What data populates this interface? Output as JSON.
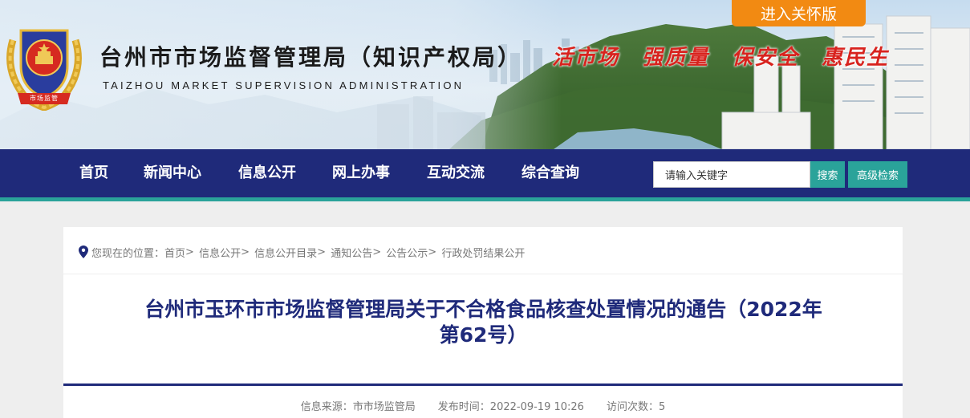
{
  "header": {
    "title_cn": "台州市市场监督管理局（知识产权局）",
    "title_en": "TAIZHOU MARKET SUPERVISION ADMINISTRATION",
    "slogan": "活市场　强质量　保安全　惠民生",
    "care_mode_label": "进入关怀版",
    "emblem_text": "市场监管",
    "colors": {
      "slogan": "#d8231e",
      "care_button": "#f28a12"
    }
  },
  "nav": {
    "items": [
      {
        "label": "首页"
      },
      {
        "label": "新闻中心"
      },
      {
        "label": "信息公开"
      },
      {
        "label": "网上办事"
      },
      {
        "label": "互动交流"
      },
      {
        "label": "综合查询"
      }
    ],
    "search": {
      "value": "请输入关键字",
      "button_label": "搜索",
      "advanced_label": "高级检索"
    },
    "colors": {
      "bar": "#1f2a7a",
      "accent": "#2aa39a"
    }
  },
  "breadcrumb": {
    "prefix": "您现在的位置：",
    "items": [
      {
        "label": "首页"
      },
      {
        "label": "信息公开"
      },
      {
        "label": "信息公开目录"
      },
      {
        "label": "通知公告"
      },
      {
        "label": "公告公示"
      },
      {
        "label": "行政处罚结果公开"
      }
    ],
    "separator": ">"
  },
  "article": {
    "title_line1": "台州市玉环市市场监督管理局关于不合格食品核查处置情况的通告（2022年",
    "title_line2": "第62号）",
    "source_label": "信息来源：",
    "source": "市市场监管局",
    "date_label": "发布时间：",
    "date": "2022-09-19 10:26",
    "views_label": "访问次数：",
    "views": "5"
  }
}
